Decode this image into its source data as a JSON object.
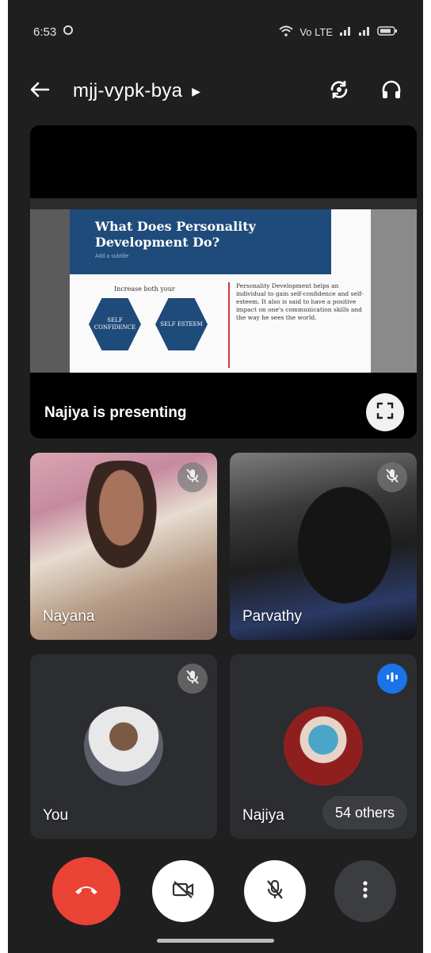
{
  "status_bar": {
    "time": "6:53",
    "right_text": "Vo LTE"
  },
  "top_bar": {
    "meeting_code": "mjj-vypk-bya"
  },
  "presentation": {
    "label": "Najiya is presenting",
    "slide": {
      "title": "What Does Personality Development Do?",
      "subtitle": "Add a subtitle",
      "left_heading": "Increase both your",
      "hex_left": "SELF CONFIDENCE",
      "hex_right": "SELF ESTEEM",
      "body": "Personality Development helps an individual to gain self-confidence and self-esteem. It also is said to have a positive impact on one's communication skills and the way he sees the world."
    }
  },
  "participants": [
    {
      "name": "Nayana",
      "muted": true
    },
    {
      "name": "Parvathy",
      "muted": true
    },
    {
      "name": "You",
      "muted": true
    },
    {
      "name": "Najiya",
      "speaking": true
    }
  ],
  "others_label": "54 others",
  "icons": {
    "back": "arrow-left-icon",
    "switch_camera": "switch-camera-icon",
    "audio": "headphones-icon",
    "fullscreen": "fullscreen-icon",
    "end_call": "end-call-icon",
    "camera": "camera-off-icon",
    "mic": "mic-off-icon",
    "more": "more-vert-icon"
  },
  "colors": {
    "end_call": "#ea4335",
    "speaking": "#1a73e8"
  }
}
